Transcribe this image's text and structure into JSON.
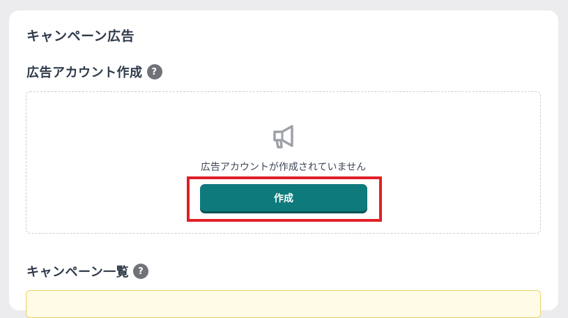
{
  "page": {
    "title": "キャンペーン広告"
  },
  "ad_account_section": {
    "title": "広告アカウント作成",
    "help_icon": "?",
    "empty_message": "広告アカウントが作成されていません",
    "create_button_label": "作成",
    "icon": "megaphone-icon"
  },
  "campaign_list_section": {
    "title": "キャンペーン一覧",
    "help_icon": "?"
  },
  "colors": {
    "accent": "#0e7a7c",
    "highlight": "#e02027",
    "notice_background": "#fffbe6"
  }
}
